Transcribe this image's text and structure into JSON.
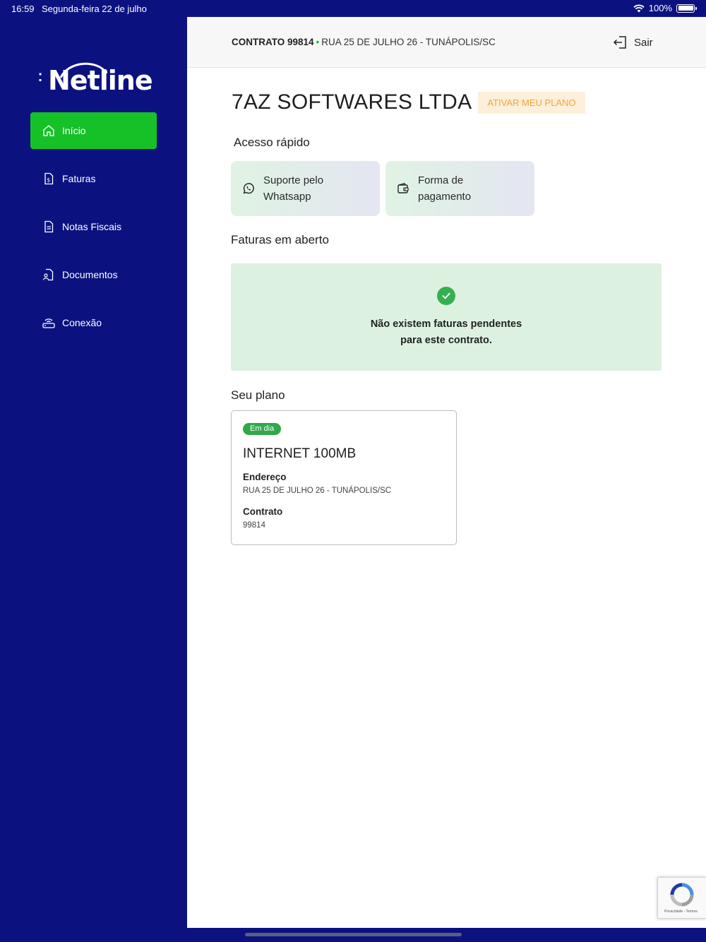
{
  "status_bar": {
    "time": "16:59",
    "date": "Segunda-feira 22 de julho",
    "battery": "100%"
  },
  "brand": {
    "name": "Netline",
    "accent_color": "#16c128",
    "sidebar_color": "#0b1280"
  },
  "sidebar": {
    "items": [
      {
        "label": "Início",
        "icon": "home-icon",
        "active": true
      },
      {
        "label": "Faturas",
        "icon": "invoice-icon",
        "active": false
      },
      {
        "label": "Notas Fiscais",
        "icon": "document-icon",
        "active": false
      },
      {
        "label": "Documentos",
        "icon": "user-document-icon",
        "active": false
      },
      {
        "label": "Conexão",
        "icon": "router-icon",
        "active": false
      }
    ]
  },
  "header": {
    "contract": "CONTRATO 99814",
    "separator": "•",
    "address": "RUA 25 DE JULHO 26 - TUNÁPOLIS/SC",
    "logout_label": "Sair"
  },
  "main": {
    "company_name": "7AZ SOFTWARES LTDA",
    "activate_label": "ATIVAR MEU PLANO",
    "quick_access_title": "Acesso rápido",
    "quick_access": [
      {
        "line1": "Suporte pelo",
        "line2": "Whatsapp",
        "icon": "whatsapp-icon"
      },
      {
        "line1": "Forma de",
        "line2": "pagamento",
        "icon": "wallet-icon"
      }
    ],
    "open_invoices_title": "Faturas em aberto",
    "no_invoices_line1": "Não existem faturas pendentes",
    "no_invoices_line2": "para este contrato.",
    "plan_title": "Seu plano",
    "plan": {
      "status": "Em dia",
      "name": "INTERNET 100MB",
      "address_label": "Endereço",
      "address_value": "RUA 25 DE JULHO 26 - TUNÁPOLIS/SC",
      "contract_label": "Contrato",
      "contract_value": "99814"
    }
  },
  "recaptcha": {
    "footer": "Privacidade - Termos"
  }
}
